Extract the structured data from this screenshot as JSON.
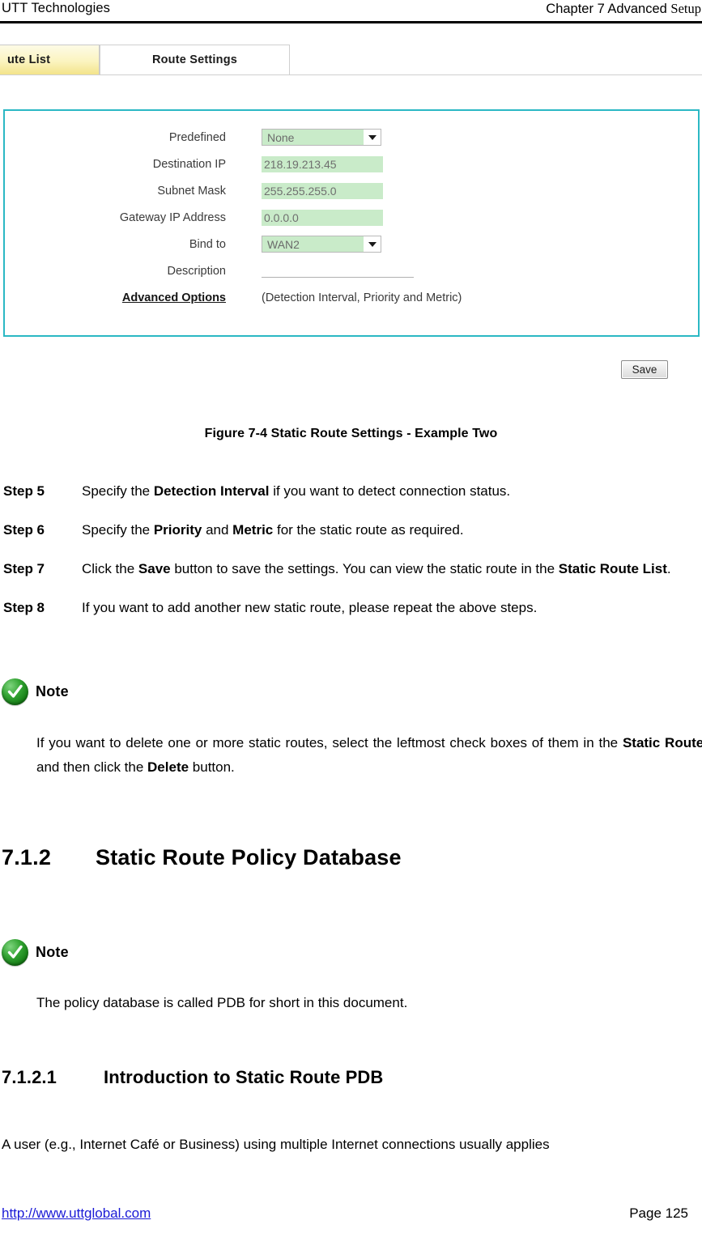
{
  "header": {
    "left_text": "UTT Technologies",
    "right_text_sans": "Chapter 7 Advanced",
    "right_text_serif": "Setup"
  },
  "figure": {
    "tabs": [
      {
        "label": "ute List",
        "full_label": "Static Route List",
        "active": false
      },
      {
        "label": "Route Settings",
        "active": true
      }
    ],
    "form": {
      "rows": [
        {
          "label": "Predefined",
          "type": "select",
          "value": "None"
        },
        {
          "label": "Destination IP",
          "type": "text",
          "value": "218.19.213.45"
        },
        {
          "label": "Subnet Mask",
          "type": "text",
          "value": "255.255.255.0"
        },
        {
          "label": "Gateway IP Address",
          "type": "text",
          "value": "0.0.0.0"
        },
        {
          "label": "Bind to",
          "type": "select",
          "value": "WAN2"
        },
        {
          "label": "Description",
          "type": "underline",
          "value": ""
        },
        {
          "label": "Advanced Options",
          "type": "link",
          "hint": "(Detection Interval, Priority and Metric)"
        }
      ]
    },
    "save_label": "Save",
    "caption": "Figure 7-4 Static Route Settings - Example Two",
    "colors": {
      "panel_border": "#2bb8c4",
      "field_background": "#c9ebc9",
      "tab_active_background": "#ffffff",
      "tab_inactive_background": "#f3e48a"
    }
  },
  "steps": [
    {
      "num": "Step 5",
      "parts": [
        {
          "text": "Specify the ",
          "bold": false
        },
        {
          "text": "Detection Interval",
          "bold": true
        },
        {
          "text": " if you want to detect connection status.",
          "bold": false
        }
      ]
    },
    {
      "num": "Step 6",
      "parts": [
        {
          "text": "Specify the ",
          "bold": false
        },
        {
          "text": "Priority",
          "bold": true
        },
        {
          "text": " and ",
          "bold": false
        },
        {
          "text": "Metric",
          "bold": true
        },
        {
          "text": " for the static route as required.",
          "bold": false
        }
      ]
    },
    {
      "num": "Step 7",
      "parts": [
        {
          "text": "Click the ",
          "bold": false
        },
        {
          "text": "Save",
          "bold": true
        },
        {
          "text": " button to save the settings. You can view the static route in the ",
          "bold": false
        },
        {
          "text": "Static Route List",
          "bold": true
        },
        {
          "text": ".",
          "bold": false
        }
      ]
    },
    {
      "num": "Step 8",
      "parts": [
        {
          "text": "If you want to add another new static route, please repeat the above steps.",
          "bold": false
        }
      ]
    }
  ],
  "note1": {
    "icon": "green-check-icon",
    "title": "Note",
    "parts": [
      {
        "text": "If you want to delete one or more static routes, select the leftmost check boxes of them in the ",
        "bold": false
      },
      {
        "text": "Static Route List",
        "bold": true
      },
      {
        "text": ", and then click the ",
        "bold": false
      },
      {
        "text": "Delete",
        "bold": true
      },
      {
        "text": " button.",
        "bold": false
      }
    ]
  },
  "section_712": {
    "number": "7.1.2",
    "title": "Static Route Policy Database"
  },
  "note2": {
    "icon": "green-check-icon",
    "title": "Note",
    "parts": [
      {
        "text": "The policy database is called PDB for short in this document.",
        "bold": false
      }
    ]
  },
  "section_7121": {
    "number": "7.1.2.1",
    "title": "Introduction to Static Route PDB"
  },
  "body_paragraph": "A user (e.g., Internet Café or Business) using multiple Internet connections usually applies",
  "footer": {
    "url": "http://www.uttglobal.com",
    "page": "Page 125"
  }
}
